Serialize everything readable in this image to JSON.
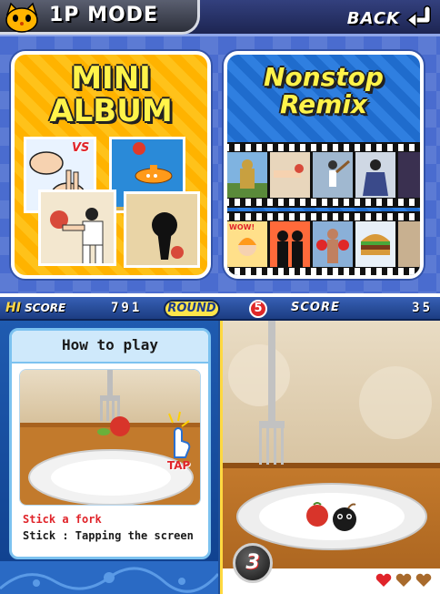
{
  "header": {
    "mode_title": "1P MODE",
    "back_label": "BACK"
  },
  "menu": {
    "mini_album": {
      "title_line1": "MINI",
      "title_line2": "ALBUM",
      "vs_label": "VS"
    },
    "remix": {
      "title_line1": "Nonstop",
      "title_line2": "Remix",
      "wow_label": "WOW!"
    }
  },
  "hud": {
    "hi_prefix": "HI",
    "hi_label": "SCORE",
    "hi_score": "791",
    "round_label": "ROUND",
    "round_number": "5",
    "score_label": "SCORE",
    "score": "35"
  },
  "howto": {
    "title": "How to play",
    "tap_label": "TAP",
    "caption": "Stick a fork",
    "instruction": "Stick : Tapping the screen"
  },
  "game": {
    "bomb_count": "3",
    "lives_total": 3,
    "lives_remaining": 1
  },
  "colors": {
    "accent_yellow": "#ffd940",
    "panel_blue": "#1f5bb0",
    "heart_red": "#e0242a",
    "heart_empty": "#a86a2c"
  }
}
